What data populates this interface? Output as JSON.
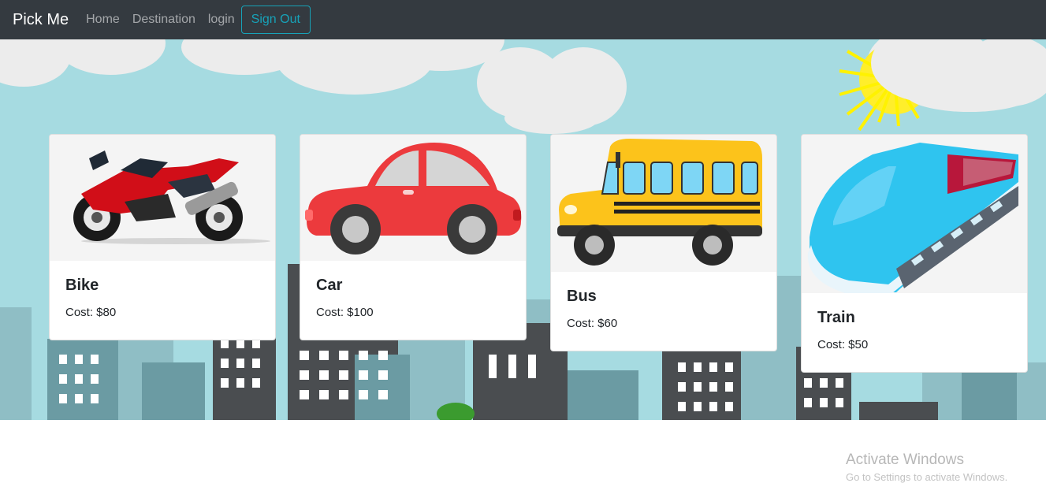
{
  "navbar": {
    "brand": "Pick Me",
    "links": [
      "Home",
      "Destination",
      "login"
    ],
    "signout_label": "Sign Out"
  },
  "cards": [
    {
      "title": "Bike",
      "cost": "Cost: $80",
      "icon": "motorcycle-icon"
    },
    {
      "title": "Car",
      "cost": "Cost: $100",
      "icon": "car-icon"
    },
    {
      "title": "Bus",
      "cost": "Cost: $60",
      "icon": "school-bus-icon"
    },
    {
      "title": "Train",
      "cost": "Cost: $50",
      "icon": "bullet-train-icon"
    }
  ],
  "watermark": {
    "title": "Activate Windows",
    "subtitle": "Go to Settings to activate Windows."
  },
  "colors": {
    "navbar_bg": "#343a40",
    "sky": "#a6dbe1",
    "signout_border": "#17a2b8"
  }
}
